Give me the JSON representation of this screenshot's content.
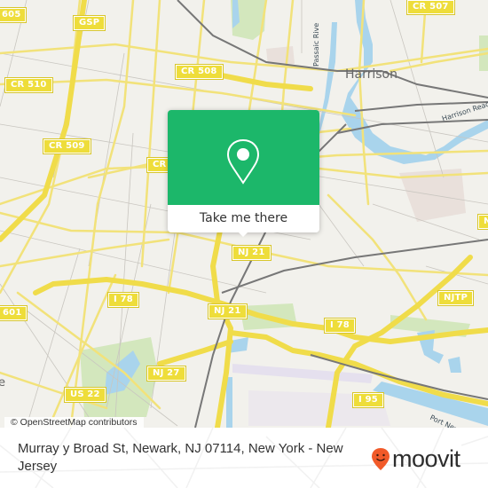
{
  "map": {
    "road_shields": [
      {
        "id": "cr605",
        "label": "605"
      },
      {
        "id": "gsp",
        "label": "GSP"
      },
      {
        "id": "cr510",
        "label": "CR 510"
      },
      {
        "id": "cr508",
        "label": "CR 508"
      },
      {
        "id": "cr509",
        "label": "CR 509"
      },
      {
        "id": "cr-partial",
        "label": "CR"
      },
      {
        "id": "cr507",
        "label": "CR 507"
      },
      {
        "id": "nj21-top",
        "label": "NJ 21"
      },
      {
        "id": "nj21-bottom",
        "label": "NJ 21"
      },
      {
        "id": "i78-left",
        "label": "I 78"
      },
      {
        "id": "i78-right",
        "label": "I 78"
      },
      {
        "id": "cr601",
        "label": "601"
      },
      {
        "id": "nj27",
        "label": "NJ 27"
      },
      {
        "id": "us22",
        "label": "US 22"
      },
      {
        "id": "njtp",
        "label": "NJTP"
      },
      {
        "id": "i95",
        "label": "I 95"
      },
      {
        "id": "nj-partial",
        "label": "N"
      }
    ],
    "place_labels": [
      {
        "id": "harrison",
        "label": "Harrison"
      },
      {
        "id": "left-edge",
        "label": "e"
      }
    ],
    "water_labels": [
      {
        "id": "passaic",
        "label": "Passaic Rive"
      },
      {
        "id": "harrison-reach",
        "label": "Harrison Reach"
      },
      {
        "id": "port-newark",
        "label": "Port New"
      }
    ],
    "attribution": "© OpenStreetMap contributors"
  },
  "popup": {
    "cta_label": "Take me there",
    "color": "#1cb76a"
  },
  "footer": {
    "address": "Murray y Broad St, Newark, NJ 07114, New York - New Jersey",
    "brand": "moovit",
    "brand_color": "#f15a29"
  }
}
